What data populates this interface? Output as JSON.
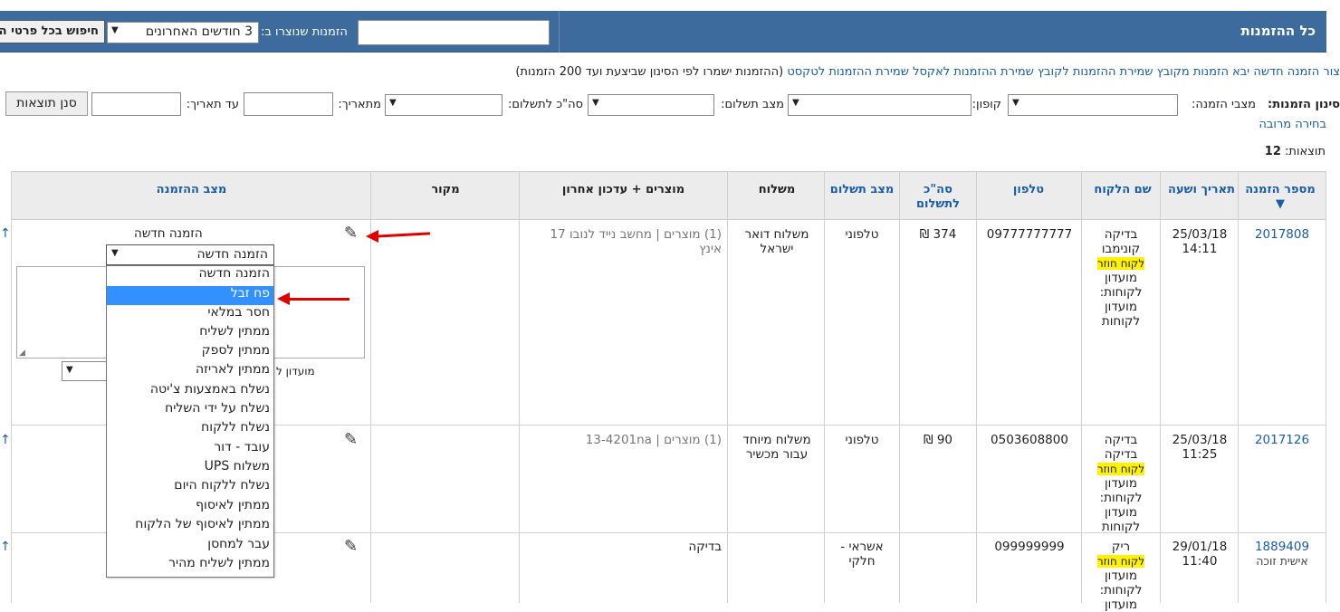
{
  "header": {
    "title": "כל ההזמנות",
    "created_label": "הזמנות שנוצרו ב:",
    "period_value": "3 חודשים האחרונים",
    "search_all_label": "חיפוש בכל פרטי ה"
  },
  "links": {
    "create_order": "צור הזמנה חדשה",
    "import_orders": "יבא הזמנות מקובץ",
    "save_file": "שמירת ההזמנות לקובץ",
    "save_excel": "שמירת ההזמנות לאקסל",
    "save_text": "שמירת ההזמנות לטקסט",
    "note": "(ההזמנות ישמרו לפי הסינון שביצעת ועד 200 הזמנות)"
  },
  "filters": {
    "title": "סינון הזמנות:",
    "status_label": "מצבי הזמנה:",
    "coupon_label": "קופון:",
    "payment_label": "מצב תשלום:",
    "total_label": "סה\"כ לתשלום:",
    "from_label": "מתאריך:",
    "to_label": "עד תאריך:",
    "filter_button": "סנן תוצאות",
    "multi_select": "בחירה מרובה"
  },
  "results": {
    "label": "תוצאות:",
    "count": "12"
  },
  "table": {
    "headers": {
      "order_number": "מספר הזמנה ▼",
      "date": "תאריך ושעה",
      "customer": "שם הלקוח",
      "phone": "טלפון",
      "total": "סה\"כ לתשלום",
      "payment_status": "מצב תשלום",
      "shipping": "משלוח",
      "products": "מוצרים + עדכון אחרון",
      "source": "מקור",
      "order_status": "מצב ההזמנה"
    },
    "rows": [
      {
        "number": "2017808",
        "date": "25/03/18",
        "time": "14:11",
        "name": "בדיקה קונימבו",
        "tag": "לקוח חוזר",
        "club": "מועדון לקוחות: מועדון לקוחות",
        "phone": "09777777777",
        "total": "374 ₪",
        "payment": "טלפוני",
        "shipping": "משלוח דואר ישראל",
        "products": "(1) מוצרים | מחשב נייד לנובו 17 אינץ",
        "source": "",
        "status": "הזמנה חדשה"
      },
      {
        "number": "2017126",
        "date": "25/03/18",
        "time": "11:25",
        "name": "בדיקה בדיקה",
        "tag": "לקוח חוזר",
        "club": "מועדון לקוחות: מועדון לקוחות",
        "phone": "0503608800",
        "total": "90 ₪",
        "payment": "טלפוני",
        "shipping": "משלוח מיוחד עבור מכשיר",
        "products": "(1) מוצרים | 13-4201na",
        "source": "",
        "status": ""
      },
      {
        "number": "1889409",
        "sub": "אישית זוכה",
        "date": "29/01/18",
        "time": "11:40",
        "name": "ריק",
        "tag": "לקוח חוזר",
        "club": "מועדון לקוחות: מועדון",
        "phone": "099999999",
        "total": "",
        "payment": "אשראי - חלקי",
        "shipping": "",
        "products": "",
        "source": "בדיקה",
        "status": ""
      }
    ]
  },
  "status_dropdown": {
    "selected": "הזמנה חדשה",
    "club_partial": "מועדון ל",
    "options": [
      "הזמנה חדשה",
      "פח זבל",
      "חסר במלאי",
      "ממתין לשליח",
      "ממתין לספק",
      "ממתין לאריזה",
      "נשלח באמצעות צ'יטה",
      "נשלח על ידי השליח",
      "נשלח ללקוח",
      "עובד - דור",
      "משלוח UPS",
      "נשלח ללקוח היום",
      "ממתין לאיסוף",
      "ממתין לאיסוף של הלקוח",
      "עבר למחסן",
      "ממתין לשליח מהיר"
    ],
    "highlighted_index": 1
  },
  "icons": {
    "pencil": "pencil-icon",
    "up_arrow": "↑"
  },
  "colors": {
    "header_bg": "#3d6b9e",
    "link": "#1a5ba8",
    "highlight": "#fff200",
    "selected_option": "#3390ff",
    "annotation_arrow": "#e00000"
  }
}
